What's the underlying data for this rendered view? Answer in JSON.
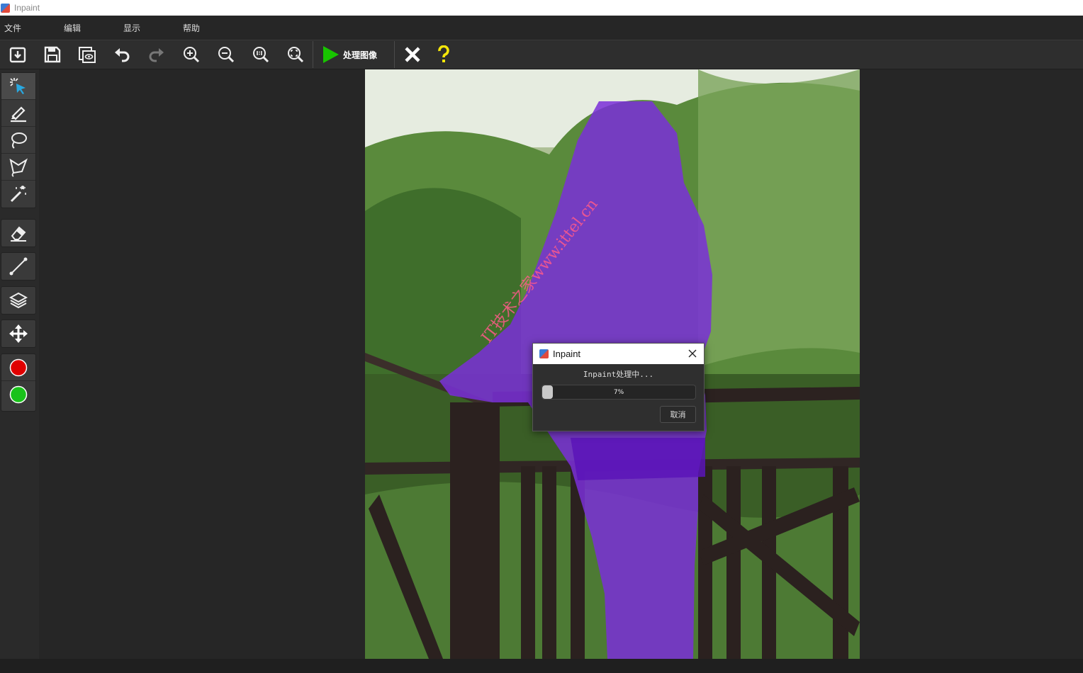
{
  "window": {
    "title": "Inpaint"
  },
  "menu": {
    "items": [
      "文件",
      "编辑",
      "显示",
      "帮助"
    ]
  },
  "toolbar": {
    "process_label": "处理图像",
    "icons": [
      "open-icon",
      "save-icon",
      "compare-icon",
      "undo-icon",
      "redo-icon",
      "zoom-in-icon",
      "zoom-out-icon",
      "zoom-actual-icon",
      "zoom-fit-icon",
      "play-icon",
      "close-x-icon",
      "help-icon"
    ]
  },
  "sidebar": {
    "tools": [
      "smart-select-icon",
      "marker-icon",
      "lasso-icon",
      "polygon-lasso-icon",
      "magic-wand-icon",
      "eraser-icon",
      "line-icon",
      "layers-icon",
      "move-icon"
    ],
    "colors": {
      "red": "#e00000",
      "green": "#19c21a"
    }
  },
  "image": {
    "watermark": "IT技术之家www.ittel.cn",
    "mask_color": "#7a2fd8"
  },
  "dialog": {
    "title": "Inpaint",
    "message": "Inpaint处理中...",
    "progress_percent": 7,
    "progress_text": "7%",
    "cancel_label": "取消"
  },
  "colors": {
    "accent_green": "#18c400",
    "help_yellow": "#f5e60a"
  }
}
